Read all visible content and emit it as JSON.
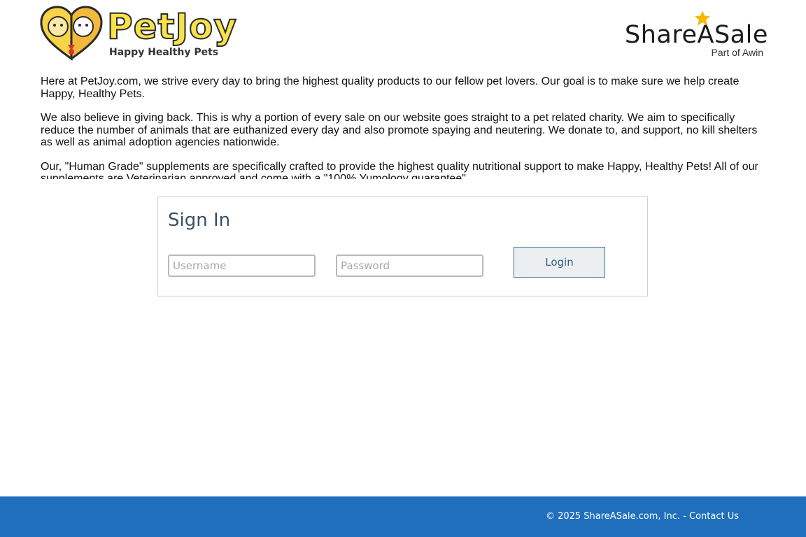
{
  "header": {
    "merchant_logo": {
      "name": "PetJoy",
      "tagline": "Happy Healthy Pets",
      "colors": {
        "heart": "#f2b93b",
        "text": "#f7e24a",
        "outline": "#2b2b2b"
      }
    },
    "network_logo": {
      "name": "ShareASale",
      "subtitle": "Part of Awin",
      "star_color": "#f5b800"
    }
  },
  "description": {
    "paragraphs": [
      "Here at PetJoy.com, we strive every day to bring the highest quality products to our fellow pet lovers. Our goal is to make sure we help create Happy, Healthy Pets.",
      "We also believe in giving back. This is why a portion of every sale on our website goes straight to a pet related charity. We aim to specifically reduce the number of animals that are euthanized every day and also promote spaying and neutering. We donate to, and support, no kill shelters as well as animal adoption agencies nationwide.",
      "Our, \"Human Grade\" supplements are specifically crafted to provide the highest quality nutritional support to make Happy, Healthy Pets! All of our supplements are Veterinarian approved and come with a \"100% Yumology guarantee\"."
    ]
  },
  "signin": {
    "title": "Sign In",
    "username_placeholder": "Username",
    "username_value": "",
    "password_placeholder": "Password",
    "password_value": "",
    "login_label": "Login"
  },
  "footer": {
    "copyright": "© 2025 ShareASale.com, Inc. - ",
    "contact_label": "Contact Us",
    "background": "#1f6fbd"
  }
}
